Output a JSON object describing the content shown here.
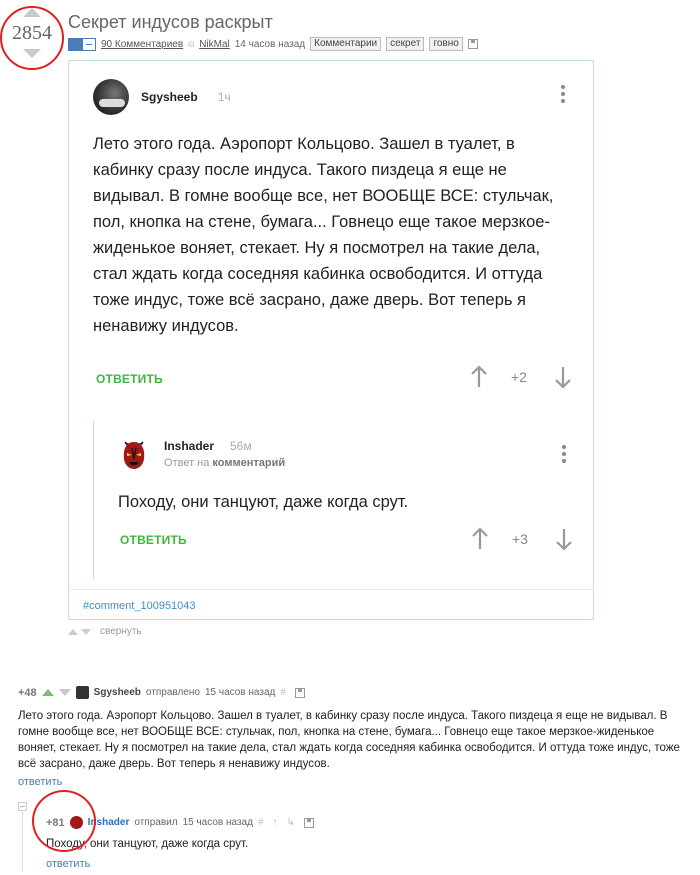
{
  "post": {
    "rating": "2854",
    "title": "Секрет индусов раскрыт",
    "comments_link": "90 Комментариев",
    "author": "NikMal",
    "time": "14 часов назад",
    "tags": [
      "Комментарии",
      "секрет",
      "говно"
    ]
  },
  "card": {
    "author": "Sgysheeb",
    "time": "1ч",
    "body": "Лето этого года. Аэропорт Кольцово. Зашел в туалет, в кабинку сразу после индуса. Такого пиздеца я еще не видывал. В гомне вообще все, нет ВООБЩЕ ВСЕ: стульчак, пол, кнопка на стене, бумага... Говнецо еще такое мерзкое-жиденькое воняет, стекает. Ну я посмотрел на такие дела, стал ждать когда соседняя кабинка освободится. И оттуда тоже индус, тоже всё засрано, даже дверь. Вот теперь я ненавижу индусов.",
    "reply_label": "ОТВЕТИТЬ",
    "votes": "+2",
    "nested": {
      "author": "Inshader",
      "time": "56м",
      "sub_prefix": "Ответ на",
      "sub_link": "комментарий",
      "body": "Походу, они танцуют, даже когда срут.",
      "reply_label": "ОТВЕТИТЬ",
      "votes": "+3"
    },
    "link": "#comment_100951043"
  },
  "collapse_label": "свернуть",
  "comment1": {
    "score": "+48",
    "author": "Sgysheeb",
    "action": "отправлено",
    "time": "15 часов назад",
    "body": "Лето этого года. Аэропорт Кольцово. Зашел в туалет, в кабинку сразу после индуса. Такого пиздеца я еще не видывал. В гомне вообще все, нет ВООБЩЕ ВСЕ: стульчак, пол, кнопка на стене, бумага... Говнецо еще такое мерзкое-жиденькое воняет, стекает. Ну я посмотрел на такие дела, стал ждать когда соседняя кабинка освободится. И оттуда тоже индус, тоже всё засрано, даже дверь. Вот теперь я ненавижу индусов.",
    "reply": "ответить"
  },
  "comment2": {
    "score": "+81",
    "author": "Inshader",
    "action": "отправил",
    "time": "15 часов назад",
    "body": "Походу, они танцуют, даже когда срут.",
    "reply": "ответить"
  }
}
